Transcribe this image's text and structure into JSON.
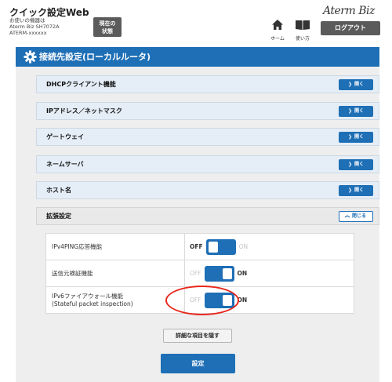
{
  "header": {
    "app_title": "クイック設定Web",
    "device_line1": "お使いの機器は",
    "device_line2": "Aterm Biz SH7072A",
    "device_line3": "ATERM-xxxxxx",
    "status_button": "現在の状態",
    "home_label": "ホーム",
    "manual_label": "使い方",
    "brand": "Aterm Biz",
    "logout_button": "ログアウト"
  },
  "panel": {
    "title": "接続先設定(ローカルルータ)",
    "sections": [
      {
        "label": "DHCPクライアント機能",
        "button": "開く"
      },
      {
        "label": "IPアドレス／ネットマスク",
        "button": "開く"
      },
      {
        "label": "ゲートウェイ",
        "button": "開く"
      },
      {
        "label": "ネームサーバ",
        "button": "開く"
      },
      {
        "label": "ホスト名",
        "button": "開く"
      },
      {
        "label": "拡張設定",
        "button": "閉じる"
      }
    ],
    "settings": [
      {
        "label": "IPv4PING応答機能",
        "label2": "",
        "off": "OFF",
        "on": "ON",
        "state": "off"
      },
      {
        "label": "送信元検証機能",
        "label2": "",
        "off": "OFF",
        "on": "ON",
        "state": "on"
      },
      {
        "label": "IPv6ファイアウォール機能",
        "label2": "(Stateful packet inspection)",
        "off": "OFF",
        "on": "ON",
        "state": "on"
      }
    ],
    "detail_button": "詳細な項目を隠す",
    "apply_button": "設定"
  },
  "colors": {
    "accent": "#1e6fb6",
    "highlight": "#e8281d",
    "header_button": "#5b5b5b"
  },
  "icons": {
    "home": "home-icon",
    "manual": "book-icon",
    "settings": "gear-icon",
    "open": "chevron-down-icon",
    "close": "chevron-up-icon"
  }
}
